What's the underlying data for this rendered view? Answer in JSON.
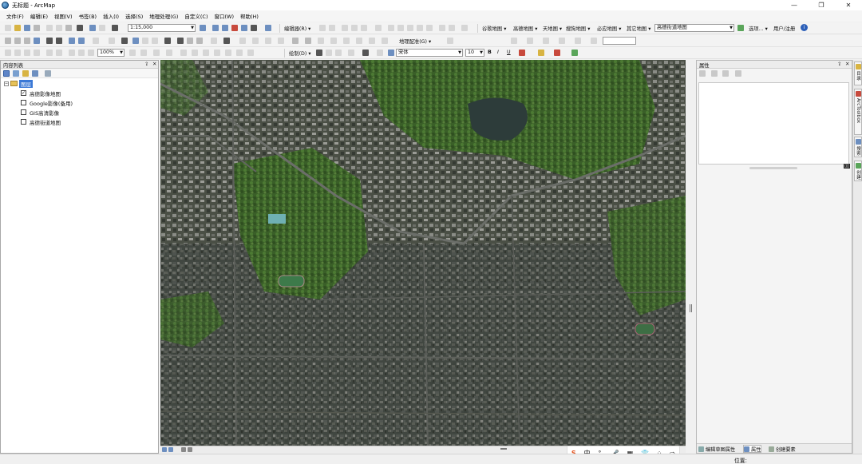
{
  "window": {
    "title": "无标题 - ArcMap",
    "minimize": "—",
    "maximize": "❐",
    "close": "✕"
  },
  "menu": [
    "文件(F)",
    "编辑(E)",
    "视图(V)",
    "书签(B)",
    "插入(I)",
    "选择(S)",
    "地理处理(G)",
    "自定义(C)",
    "窗口(W)",
    "帮助(H)"
  ],
  "toolbar1": {
    "scale": "1:15,000",
    "editor": "编辑器(R) ▾",
    "basemaps": [
      "谷歌地图 ▾",
      "高德地图 ▾",
      "天地图 ▾",
      "搜狗地图 ▾",
      "必应地图 ▾",
      "其它地图 ▾"
    ],
    "basemap_select": "高德街道地图",
    "options": "选项... ▾",
    "user": "用户/注册",
    "info": "i"
  },
  "toolbar2": {
    "zoom": "100%",
    "georef": "地理配准(G) ▾"
  },
  "toolbar3": {
    "draw": "绘制(D) ▾",
    "font": "宋体",
    "font_size": "10",
    "bold": "B",
    "italic": "I",
    "underline": "U"
  },
  "toc": {
    "title": "内容列表",
    "pin": "⇪",
    "close": "✕",
    "group": {
      "label": "图层",
      "expander": "−"
    },
    "layers": [
      {
        "label": "高德影像地图",
        "checked": "✓"
      },
      {
        "label": "Google影像(备用)",
        "checked": ""
      },
      {
        "label": "GIS高清影像",
        "checked": ""
      },
      {
        "label": "高德街道地图",
        "checked": ""
      }
    ]
  },
  "props": {
    "title": "属性",
    "pin": "⇪",
    "close": "✕",
    "size_badge": "▯▯",
    "tabs": [
      "编辑草图属性",
      "属性",
      "创建要素"
    ]
  },
  "vtabs": [
    "目录",
    "ArcToolbox",
    "搜索",
    "创建"
  ],
  "status": {
    "position_label": "位置:"
  },
  "ime": [
    "S",
    "中",
    "°,",
    "🎤",
    "▦",
    "👕",
    "⁘",
    "⇨"
  ],
  "colors": {
    "accent": "#3a78d6",
    "map_dark": "#3c4536",
    "map_green": "#3f6b2c"
  }
}
